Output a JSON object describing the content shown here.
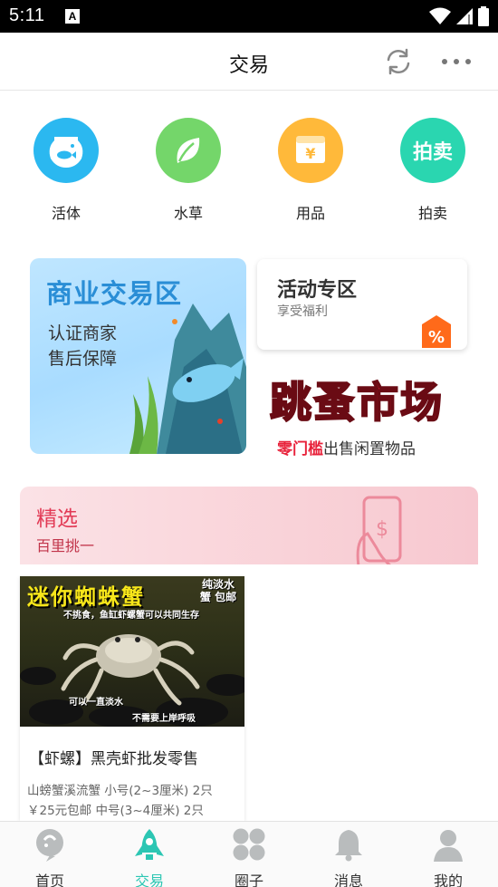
{
  "status_bar": {
    "time": "5:11",
    "notification_icon": "A"
  },
  "header": {
    "title": "交易"
  },
  "categories": [
    {
      "label": "活体",
      "icon": "fishbowl-icon",
      "color": "#2bb8f0"
    },
    {
      "label": "水草",
      "icon": "leaf-icon",
      "color": "#74d66a"
    },
    {
      "label": "用品",
      "icon": "yen-coin-icon",
      "color": "#ffb93a"
    },
    {
      "label": "拍卖",
      "icon": "auction-text-icon",
      "color": "#2ad6b0",
      "icon_text": "拍卖"
    }
  ],
  "promo": {
    "business_title": "商业交易区",
    "business_line1": "认证商家",
    "business_line2": "售后保障",
    "event_title": "活动专区",
    "event_subtitle": "享受福利",
    "badge_symbol": "%",
    "flea_logo": "跳蚤市场",
    "flea_caption_highlight": "零门槛",
    "flea_caption_rest": "出售闲置物品"
  },
  "featured": {
    "title": "精选",
    "subtitle": "百里挑一"
  },
  "products": [
    {
      "image_text_main": "迷你蜘蛛蟹",
      "image_text_tag": "纯淡水蟹 包邮",
      "image_text_sub": "不挑食，鱼缸虾螺蟹可以共同生存",
      "image_text_bottom1": "可以一直淡水",
      "image_text_bottom2": "不需要上岸呼吸",
      "title": "【虾螺】黑壳虾批发零售",
      "description": "山螃蟹溪流蟹 小号(2~3厘米) 2只 ￥25元包邮 中号(3~4厘米) 2只"
    }
  ],
  "tabbar": [
    {
      "label": "首页",
      "icon": "home-icon",
      "active": false
    },
    {
      "label": "交易",
      "icon": "rocket-icon",
      "active": true
    },
    {
      "label": "圈子",
      "icon": "circles-grid-icon",
      "active": false
    },
    {
      "label": "消息",
      "icon": "bell-icon",
      "active": false
    },
    {
      "label": "我的",
      "icon": "user-icon",
      "active": false
    }
  ],
  "colors": {
    "accent": "#2cc6b3",
    "business_blue": "#2a8ed6",
    "featured_red": "#e23a55",
    "badge_orange": "#ff6a1a"
  }
}
